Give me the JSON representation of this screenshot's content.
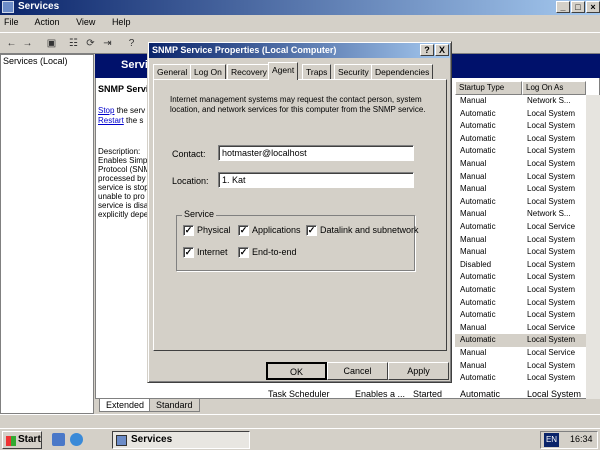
{
  "window": {
    "title": "Services"
  },
  "menubar": [
    "File",
    "Action",
    "View",
    "Help"
  ],
  "tree": {
    "root": "Services (Local)"
  },
  "band_title": "Servi",
  "description": {
    "service_name": "SNMP Servi",
    "stop_link": "Stop",
    "stop_suffix": " the serv",
    "restart_link": "Restart",
    "restart_suffix": " the s",
    "body": "Description:\nEnables Simpl\nProtocol (SNM\nprocessed by\nservice is stop\nunable to pro\nservice is disa\nexplicitly depe"
  },
  "columns": {
    "startup": "Startup Type",
    "logon": "Log On As"
  },
  "rows": [
    {
      "startup": "Manual",
      "logon": "Network S..."
    },
    {
      "startup": "Automatic",
      "logon": "Local System"
    },
    {
      "startup": "Automatic",
      "logon": "Local System"
    },
    {
      "startup": "Automatic",
      "logon": "Local System"
    },
    {
      "startup": "Automatic",
      "logon": "Local System"
    },
    {
      "startup": "Manual",
      "logon": "Local System"
    },
    {
      "startup": "Manual",
      "logon": "Local System"
    },
    {
      "startup": "Manual",
      "logon": "Local System"
    },
    {
      "startup": "Automatic",
      "logon": "Local System"
    },
    {
      "startup": "Manual",
      "logon": "Network S..."
    },
    {
      "startup": "Automatic",
      "logon": "Local Service"
    },
    {
      "startup": "Manual",
      "logon": "Local System"
    },
    {
      "startup": "Manual",
      "logon": "Local System"
    },
    {
      "startup": "Disabled",
      "logon": "Local System"
    },
    {
      "startup": "Automatic",
      "logon": "Local System"
    },
    {
      "startup": "Automatic",
      "logon": "Local System"
    },
    {
      "startup": "Automatic",
      "logon": "Local System"
    },
    {
      "startup": "Automatic",
      "logon": "Local System"
    },
    {
      "startup": "Manual",
      "logon": "Local Service"
    },
    {
      "startup": "Automatic",
      "logon": "Local System",
      "selected": true
    },
    {
      "startup": "Manual",
      "logon": "Local Service"
    },
    {
      "startup": "Manual",
      "logon": "Local System"
    },
    {
      "startup": "Automatic",
      "logon": "Local System"
    }
  ],
  "last_row": {
    "name": "Task Scheduler",
    "description": "Enables a ...",
    "status": "Started",
    "startup": "Automatic",
    "logon": "Local System"
  },
  "bottom_tabs": {
    "extended": "Extended",
    "standard": "Standard"
  },
  "taskbar": {
    "start": "Start",
    "task": "Services",
    "lang": "EN",
    "clock": "16:34"
  },
  "dialog": {
    "title": "SNMP Service Properties (Local Computer)",
    "help_btn": "?",
    "close_btn": "X",
    "tabs": [
      "General",
      "Log On",
      "Recovery",
      "Agent",
      "Traps",
      "Security",
      "Dependencies"
    ],
    "active_tab": "Agent",
    "intro": "Internet management systems may request the contact person, system location, and network services for this computer from the SNMP service.",
    "contact_label": "Contact:",
    "contact_value": "hotmaster@localhost",
    "location_label": "Location:",
    "location_value": "1. Kat",
    "service_group": "Service",
    "checks": {
      "physical": {
        "label": "Physical",
        "checked": true
      },
      "applications": {
        "label": "Applications",
        "checked": true
      },
      "datalink": {
        "label": "Datalink and subnetwork",
        "checked": true
      },
      "internet": {
        "label": "Internet",
        "checked": true
      },
      "endtoend": {
        "label": "End-to-end",
        "checked": true
      }
    },
    "buttons": {
      "ok": "OK",
      "cancel": "Cancel",
      "apply": "Apply"
    }
  }
}
